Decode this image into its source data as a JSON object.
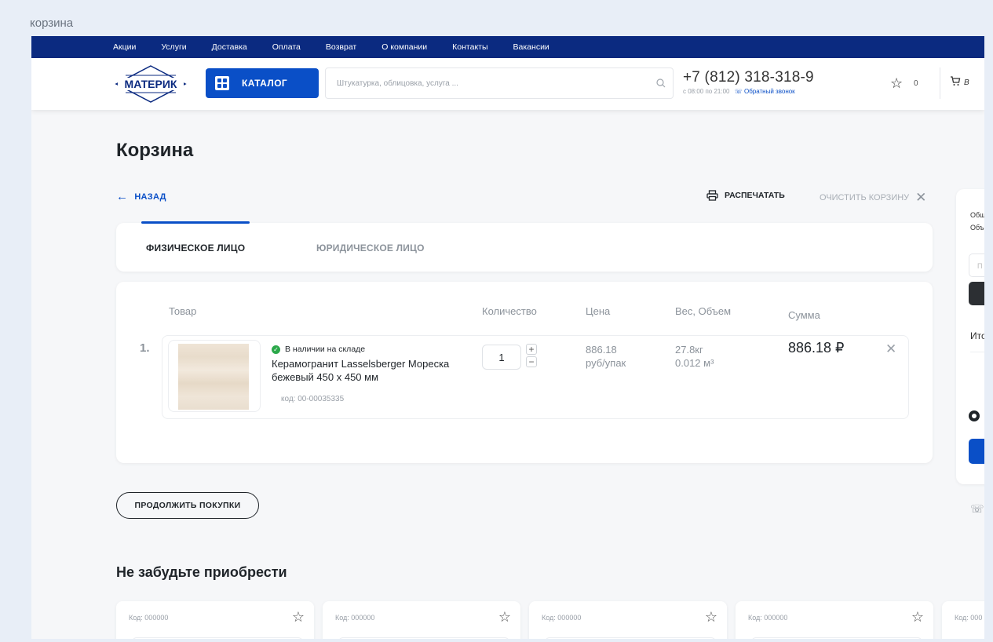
{
  "window": {
    "label": "корзина"
  },
  "topnav": {
    "items": [
      "Акции",
      "Услуги",
      "Доставка",
      "Оплата",
      "Возврат",
      "О компании",
      "Контакты",
      "Вакансии"
    ]
  },
  "header": {
    "logo_text": "МАТЕРИК",
    "catalog_label": "КАТАЛОГ",
    "search_placeholder": "Штукатурка, облицовка, услуга ...",
    "phone": "+7 (812) 318-318-9",
    "hours": "с 08:00 по 21:00",
    "callback": "Обратный звонок",
    "favorites_count": "0",
    "cart_label": "В"
  },
  "page": {
    "title": "Корзина",
    "back_label": "НАЗАД",
    "print_label": "РАСПЕЧАТАТЬ",
    "clear_label": "ОЧИСТИТЬ КОРЗИНУ"
  },
  "tabs": [
    {
      "label": "ФИЗИЧЕСКОЕ ЛИЦО",
      "active": true
    },
    {
      "label": "ЮРИДИЧЕСКОЕ ЛИЦО",
      "active": false
    }
  ],
  "cart": {
    "columns": {
      "product": "Товар",
      "qty": "Количество",
      "price": "Цена",
      "weight": "Вес, Объем",
      "sum": "Сумма"
    },
    "items": [
      {
        "index": "1.",
        "stock": "В наличии на складе",
        "name": "Керамогранит Lasselsberger Мореска бежевый 450 х 450 мм",
        "code": "код: 00-00035335",
        "qty": "1",
        "price": "886.18",
        "price_unit": "руб/упак",
        "weight": "27.8кг",
        "volume": "0.012 м³",
        "sum": "886.18 ₽"
      }
    ]
  },
  "continue_label": "ПРОДОЛЖИТЬ ПОКУПКИ",
  "recommend": {
    "title": "Не забудьте приобрести",
    "cards": [
      {
        "code": "Код: 000000"
      },
      {
        "code": "Код: 000000"
      },
      {
        "code": "Код: 000000"
      },
      {
        "code": "Код: 000000"
      },
      {
        "code": "Код: 000"
      }
    ]
  },
  "sidebar": {
    "line1": "Общ",
    "line2": "Объ",
    "input_placeholder": "П",
    "total_label": "Ито"
  },
  "colors": {
    "accent": "#0a4fc7",
    "nav": "#0b2a80",
    "stock_ok": "#2ba84a"
  }
}
